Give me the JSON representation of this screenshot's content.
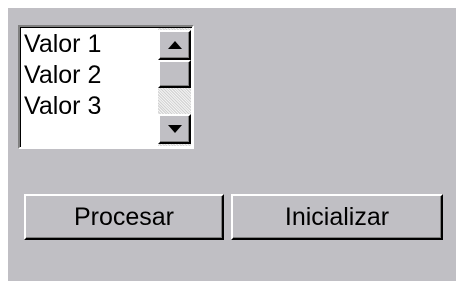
{
  "listbox": {
    "items": [
      {
        "label": "Valor 1"
      },
      {
        "label": "Valor 2"
      },
      {
        "label": "Valor 3"
      }
    ],
    "scroll_up_icon": "arrow-up-icon",
    "scroll_down_icon": "arrow-down-icon"
  },
  "buttons": {
    "process_label": "Procesar",
    "reset_label": "Inicializar"
  },
  "colors": {
    "panel_background": "#c0bfc4",
    "list_background": "#ffffff",
    "text": "#000000"
  }
}
